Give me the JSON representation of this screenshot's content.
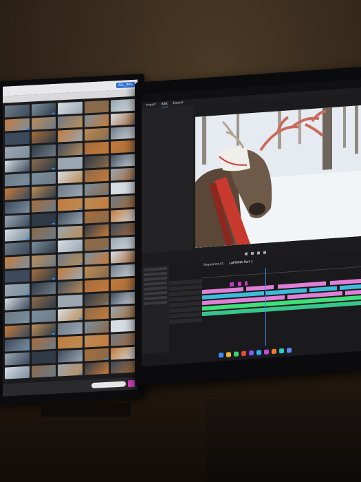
{
  "left_monitor": {
    "tab_label": "ALL_IMG",
    "thumbnail_colors": [
      "#6d7a86",
      "#8a6a4a",
      "#3c4a5c",
      "#b98c58",
      "#d7dde3",
      "#2f3a46",
      "#c47a3a",
      "#7b8f9e",
      "#9aa7b1",
      "#a56c3c"
    ],
    "thumbnail_count": 100
  },
  "right_monitor": {
    "menu": [
      "Import",
      "Edit",
      "Export"
    ],
    "sequence_tabs": [
      "Sequence 01",
      "LAPONIA Part 1"
    ],
    "clip_colors": {
      "video": "#3dbcd8",
      "pink": "#e07fd8",
      "magenta": "#c43cc6",
      "green": "#3ee07a",
      "audio": "#38c48a"
    },
    "taskbar_icon_colors": [
      "#3b8bf5",
      "#f2b53a",
      "#3ad06a",
      "#e84a3a",
      "#7a5cf0",
      "#2ab0f5",
      "#c04ad8",
      "#f57a2a",
      "#2ad0c0",
      "#5a8af5"
    ]
  }
}
